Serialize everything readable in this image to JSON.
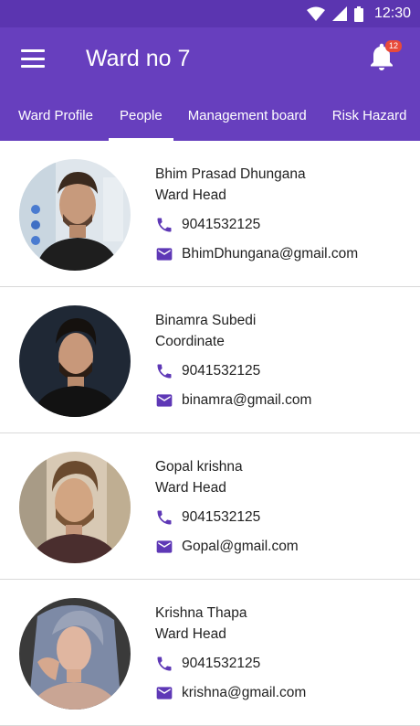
{
  "status_bar": {
    "time": "12:30"
  },
  "header": {
    "title": "Ward no 7",
    "notification_count": "12"
  },
  "tabs": [
    {
      "label": "Ward Profile"
    },
    {
      "label": "People",
      "active": true
    },
    {
      "label": "Management board"
    },
    {
      "label": "Risk Hazard"
    }
  ],
  "people": [
    {
      "name": "Bhim Prasad Dhungana",
      "role": "Ward Head",
      "phone": "9041532125",
      "email": "BhimDhungana@gmail.com"
    },
    {
      "name": "Binamra Subedi",
      "role": "Coordinate",
      "phone": "9041532125",
      "email": "binamra@gmail.com"
    },
    {
      "name": "Gopal krishna",
      "role": "Ward Head",
      "phone": "9041532125",
      "email": "Gopal@gmail.com"
    },
    {
      "name": "Krishna Thapa",
      "role": "Ward Head",
      "phone": "9041532125",
      "email": "krishna@gmail.com"
    }
  ],
  "colors": {
    "primary": "#673fbe",
    "status_bar": "#5b35b0",
    "accent_icon": "#5e38b6",
    "badge": "#e84a3a"
  }
}
